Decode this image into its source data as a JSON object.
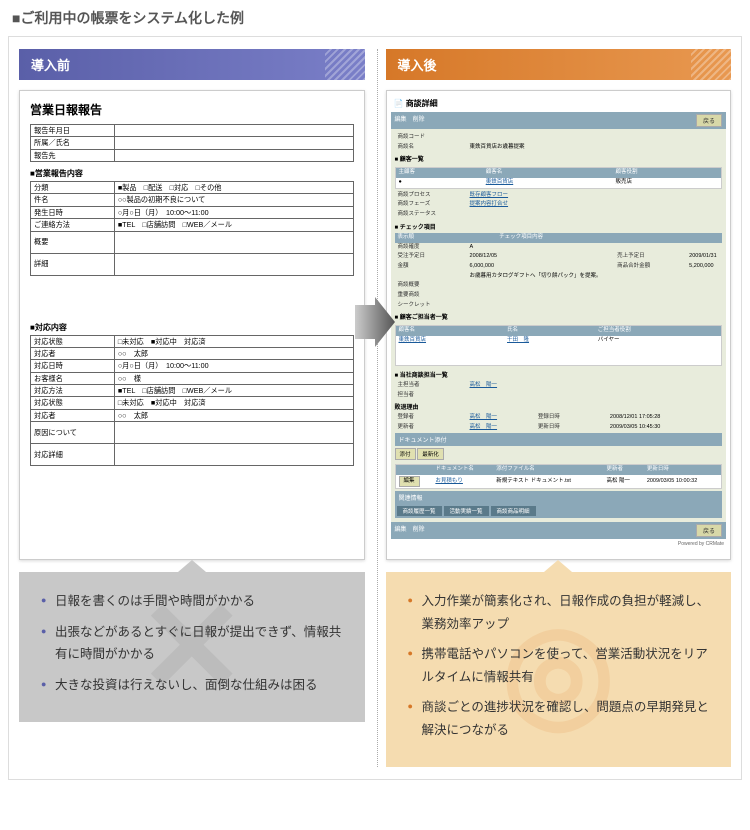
{
  "page_title": "■ご利用中の帳票をシステム化した例",
  "before": {
    "header": "導入前",
    "doc_title": "営業日報報告",
    "top_fields": [
      {
        "label": "報告年月日",
        "value": ""
      },
      {
        "label": "所属／氏名",
        "value": ""
      },
      {
        "label": "報告先",
        "value": ""
      }
    ],
    "sec1_h": "■営業報告内容",
    "sec1": [
      {
        "label": "分類",
        "value": "■製品　□配送　□対応　□その他"
      },
      {
        "label": "件名",
        "value": "○○製品の初期不良について"
      },
      {
        "label": "発生日時",
        "value": "○月○日（月）　10:00〜11:00"
      },
      {
        "label": "ご連絡方法",
        "value": "■TEL　□店舗訪問　□WEB／メール"
      },
      {
        "label": "概要",
        "value": ""
      },
      {
        "label": "詳細",
        "value": ""
      }
    ],
    "sec2_h": "■対応内容",
    "sec2": [
      {
        "label": "対応状態",
        "value": "□未対応　■対応中　対応済"
      },
      {
        "label": "対応者",
        "value": "○○　太郎"
      },
      {
        "label": "対応日時",
        "value": "○月○日（月）　10:00〜11:00"
      },
      {
        "label": "お客様名",
        "value": "○○　様"
      },
      {
        "label": "対応方法",
        "value": "■TEL　□店舗訪問　□WEB／メール"
      },
      {
        "label": "対応状態",
        "value": "□未対応　■対応中　対応済"
      },
      {
        "label": "対応者",
        "value": "○○　太郎"
      },
      {
        "label": "原因について",
        "value": ""
      },
      {
        "label": "対応詳細",
        "value": ""
      }
    ],
    "bullets": [
      "日報を書くのは手間や時間がかかる",
      "出張などがあるとすぐに日報が提出できず、情報共有に時間がかかる",
      "大きな投資は行えないし、面倒な仕組みは困る"
    ]
  },
  "after": {
    "header": "導入後",
    "app_title": "商談詳細",
    "bar": {
      "edit": "編集",
      "del": "削除",
      "back": "戻る"
    },
    "rows1": [
      {
        "k": "商談コード",
        "v": ""
      },
      {
        "k": "商談名",
        "v": "東鉄百貨店お歳暮提案"
      }
    ],
    "cust_h": "■ 顧客一覧",
    "cust_head": [
      "主顧客",
      "顧客名",
      "顧客役割"
    ],
    "cust_row": [
      "●",
      "東鉄百貨店",
      "販売店"
    ],
    "rows2": [
      {
        "k": "商談プロセス",
        "v": "既存顧客フロー"
      },
      {
        "k": "商談フェーズ",
        "v": "提案内容打合せ"
      },
      {
        "k": "商談ステータス",
        "v": ""
      }
    ],
    "chk_h": "■ チェック項目",
    "chk_head": [
      "表示順",
      "チェック項目内容"
    ],
    "rows3": [
      {
        "k": "商談確度",
        "v": "A"
      },
      {
        "k": "受注予定日",
        "v": "2008/12/05",
        "k2": "売上予定日",
        "v2": "2009/01/31"
      },
      {
        "k": "金額",
        "v": "6,000,000",
        "k2": "商品合計金額",
        "v2": "5,200,000"
      },
      {
        "k": "",
        "v": "お歳暮用カタログギフトへ「切り餅パック」を提案。"
      }
    ],
    "rows4": [
      {
        "k": "商談概要",
        "v": ""
      },
      {
        "k": "重要商談",
        "v": ""
      },
      {
        "k": "シークレット",
        "v": ""
      }
    ],
    "person_h": "■ 顧客ご担当者一覧",
    "person_head": [
      "顧客名",
      "氏名",
      "ご担当者役割"
    ],
    "person_rows": [
      [
        "東鉄百貨店",
        "干田　隆",
        "バイヤー"
      ]
    ],
    "own_h": "■ 当社商談担当一覧",
    "own": [
      {
        "k": "主担当者",
        "v": "高松　陽一"
      },
      {
        "k": "担当者",
        "v": ""
      }
    ],
    "reason_h": "敗退理由",
    "reg": [
      {
        "k1": "登録者",
        "v1": "高松　陽一",
        "k2": "登録日時",
        "v2": "2008/12/01 17:05:28"
      },
      {
        "k1": "更新者",
        "v1": "高松　陽一",
        "k2": "更新日時",
        "v2": "2009/03/05 10:45:30"
      }
    ],
    "docsec_h": "ドキュメント添付",
    "docsec_tab": [
      "添付",
      "最新化"
    ],
    "docsec_head": [
      "",
      "ドキュメント名",
      "添付ファイル名",
      "更新者",
      "更新日時"
    ],
    "docsec_row": [
      "編集",
      "お見積もり",
      "新規テキスト ドキュメント.txt",
      "高松 陽一",
      "2009/03/05 10:00:32"
    ],
    "rel_h": "関連情報",
    "rel_tabs": [
      "商談履歴一覧",
      "活動実績一覧",
      "商談商品明細"
    ],
    "powered": "Powered by CRMate",
    "bullets": [
      "入力作業が簡素化され、日報作成の負担が軽減し、業務効率アップ",
      "携帯電話やパソコンを使って、営業活動状況をリアルタイムに情報共有",
      "商談ごとの進捗状況を確認し、問題点の早期発見と解決につながる"
    ]
  }
}
